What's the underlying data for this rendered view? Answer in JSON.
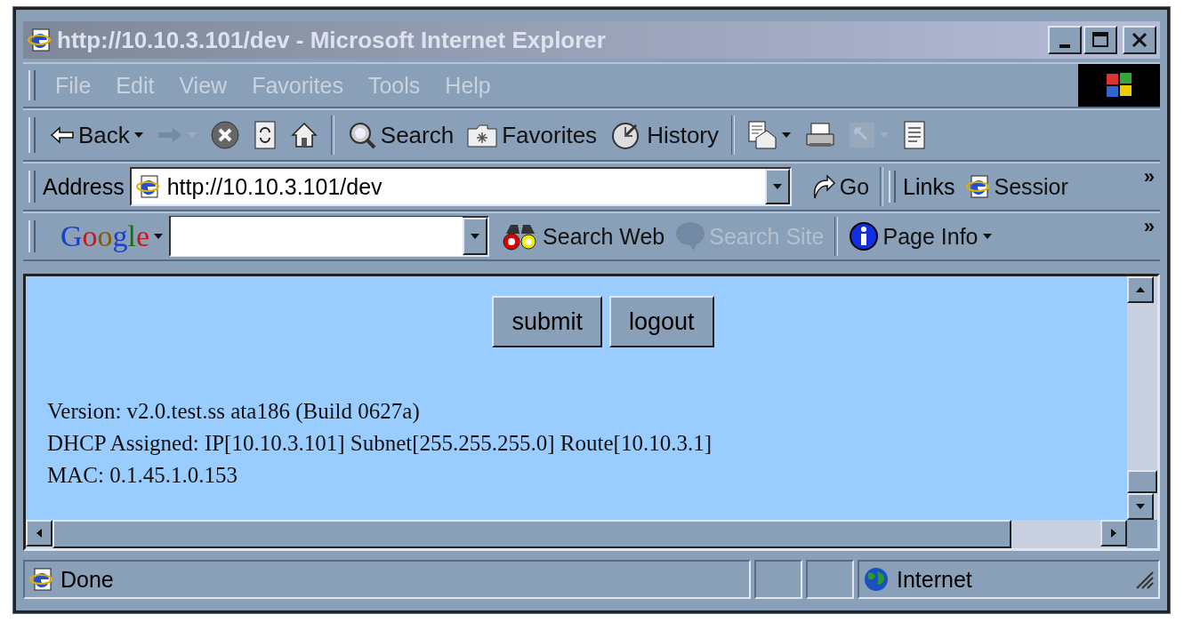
{
  "window": {
    "title": "http://10.10.3.101/dev - Microsoft Internet Explorer"
  },
  "menu": [
    {
      "label": "File"
    },
    {
      "label": "Edit"
    },
    {
      "label": "View"
    },
    {
      "label": "Favorites"
    },
    {
      "label": "Tools"
    },
    {
      "label": "Help"
    }
  ],
  "toolbar": [
    {
      "kind": "back",
      "label": "Back",
      "dropdown": true,
      "disabled": false
    },
    {
      "kind": "forward",
      "dropdown": true,
      "disabled": true
    },
    {
      "kind": "stop",
      "disabled": false
    },
    {
      "kind": "refresh",
      "disabled": false
    },
    {
      "kind": "home",
      "disabled": false
    },
    {
      "kind": "separator"
    },
    {
      "kind": "search",
      "label": "Search",
      "disabled": false
    },
    {
      "kind": "favorites",
      "label": "Favorites",
      "disabled": false
    },
    {
      "kind": "history",
      "label": "History",
      "disabled": false
    },
    {
      "kind": "separator"
    },
    {
      "kind": "mail",
      "dropdown": true,
      "disabled": false
    },
    {
      "kind": "print",
      "disabled": false
    },
    {
      "kind": "edit",
      "dropdown": true,
      "disabled": true
    },
    {
      "kind": "discuss",
      "disabled": false
    }
  ],
  "address_bar": {
    "label": "Address",
    "value": "http://10.10.3.101/dev",
    "go": "Go",
    "links_label": "Links",
    "links": [
      {
        "label": "Sessior"
      }
    ],
    "more": "»"
  },
  "google_bar": {
    "logo": "Google",
    "search_field": {
      "kind": "combo"
    },
    "buttons": [
      {
        "kind": "search-web",
        "label": "Search Web",
        "disabled": false,
        "dropdown": false
      },
      {
        "kind": "search-site",
        "label": "Search Site",
        "disabled": true,
        "dropdown": false
      },
      {
        "kind": "separator"
      },
      {
        "kind": "page-info",
        "label": "Page Info",
        "disabled": false,
        "dropdown": true
      }
    ],
    "more": "»"
  },
  "page": {
    "buttons": [
      {
        "label": "submit"
      },
      {
        "label": "logout"
      }
    ],
    "lines": [
      "Version: v2.0.test.ss ata186 (Build 0627a)",
      "DHCP Assigned: IP[10.10.3.101] Subnet[255.255.255.0] Route[10.10.3.1]",
      "MAC: 0.1.45.1.0.153"
    ]
  },
  "status_bar": {
    "text": "Done",
    "zone": "Internet"
  }
}
